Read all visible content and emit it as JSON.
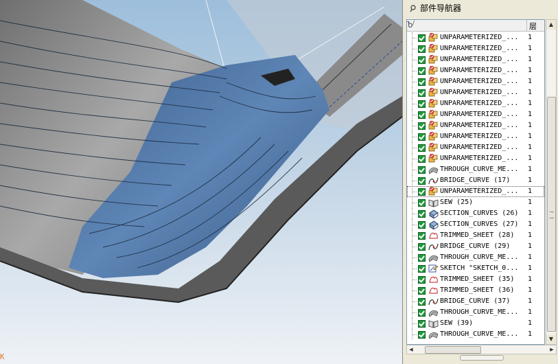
{
  "navigator": {
    "title": "部件导航器",
    "col_corner": "Ⴆ",
    "col_mark": "/",
    "col_layer": "层",
    "items": [
      {
        "name": "UNPARAMETERIZED_...",
        "layer": "1",
        "icon": "unparameterized-feature-icon"
      },
      {
        "name": "UNPARAMETERIZED_...",
        "layer": "1",
        "icon": "unparameterized-feature-icon"
      },
      {
        "name": "UNPARAMETERIZED_...",
        "layer": "1",
        "icon": "unparameterized-feature-icon"
      },
      {
        "name": "UNPARAMETERIZED_...",
        "layer": "1",
        "icon": "unparameterized-feature-icon"
      },
      {
        "name": "UNPARAMETERIZED_...",
        "layer": "1",
        "icon": "unparameterized-feature-icon"
      },
      {
        "name": "UNPARAMETERIZED_...",
        "layer": "1",
        "icon": "unparameterized-feature-icon"
      },
      {
        "name": "UNPARAMETERIZED_...",
        "layer": "1",
        "icon": "unparameterized-feature-icon"
      },
      {
        "name": "UNPARAMETERIZED_...",
        "layer": "1",
        "icon": "unparameterized-feature-icon"
      },
      {
        "name": "UNPARAMETERIZED_...",
        "layer": "1",
        "icon": "unparameterized-feature-icon"
      },
      {
        "name": "UNPARAMETERIZED_...",
        "layer": "1",
        "icon": "unparameterized-feature-icon"
      },
      {
        "name": "UNPARAMETERIZED_...",
        "layer": "1",
        "icon": "unparameterized-feature-icon"
      },
      {
        "name": "UNPARAMETERIZED_...",
        "layer": "1",
        "icon": "unparameterized-feature-icon"
      },
      {
        "name": "THROUGH_CURVE_ME...",
        "layer": "1",
        "icon": "through-curve-mesh-icon"
      },
      {
        "name": "BRIDGE_CURVE (17)",
        "layer": "1",
        "icon": "bridge-curve-icon"
      },
      {
        "name": "UNPARAMETERIZED_...",
        "layer": "1",
        "icon": "unparameterized-feature-icon",
        "selected": true
      },
      {
        "name": "SEW (25)",
        "layer": "1",
        "icon": "sew-icon"
      },
      {
        "name": "SECTION_CURVES (26)",
        "layer": "1",
        "icon": "section-curves-icon"
      },
      {
        "name": "SECTION_CURVES (27)",
        "layer": "1",
        "icon": "section-curves-icon"
      },
      {
        "name": "TRIMMED_SHEET (28)",
        "layer": "1",
        "icon": "trimmed-sheet-icon"
      },
      {
        "name": "BRIDGE_CURVE (29)",
        "layer": "1",
        "icon": "bridge-curve-icon"
      },
      {
        "name": "THROUGH_CURVE_ME...",
        "layer": "1",
        "icon": "through-curve-mesh-icon"
      },
      {
        "name": "SKETCH \"SKETCH_0...",
        "layer": "1",
        "icon": "sketch-icon"
      },
      {
        "name": "TRIMMED_SHEET (35)",
        "layer": "1",
        "icon": "trimmed-sheet-icon"
      },
      {
        "name": "TRIMMED_SHEET (36)",
        "layer": "1",
        "icon": "trimmed-sheet-icon"
      },
      {
        "name": "BRIDGE_CURVE (37)",
        "layer": "1",
        "icon": "bridge-curve-icon"
      },
      {
        "name": "THROUGH_CURVE_ME...",
        "layer": "1",
        "icon": "through-curve-mesh-icon"
      },
      {
        "name": "SEW (39)",
        "layer": "1",
        "icon": "sew-icon"
      },
      {
        "name": "THROUGH_CURVE_ME...",
        "layer": "1",
        "icon": "through-curve-mesh-icon"
      }
    ]
  },
  "viewport": {
    "corner_glyph": "K"
  },
  "colors": {
    "surface_blue": "#4f77a6",
    "surface_grey": "#8e8e8e",
    "sky_top": "#9fbfdc",
    "check_green": "#1f9a3b"
  }
}
